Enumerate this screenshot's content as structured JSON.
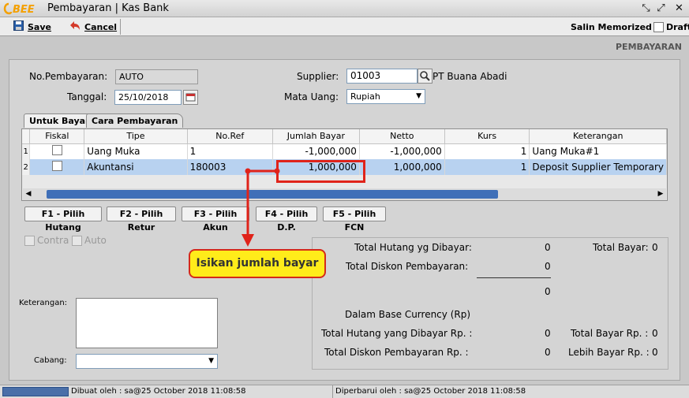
{
  "window": {
    "logo": "BEE",
    "title": "Pembayaran | Kas Bank"
  },
  "toolbar": {
    "save_label": "Save",
    "cancel_label": "Cancel",
    "salin_memorized": "Salin Memorized",
    "draft_label": "Draft"
  },
  "header": {
    "section_title": "PEMBAYARAN"
  },
  "form": {
    "no_pembayaran_label": "No.Pembayaran:",
    "no_pembayaran_value": "AUTO",
    "tanggal_label": "Tanggal:",
    "tanggal_value": "25/10/2018",
    "supplier_label": "Supplier:",
    "supplier_code": "01003",
    "supplier_name": "PT Buana Abadi",
    "mata_uang_label": "Mata Uang:",
    "mata_uang_value": "Rupiah"
  },
  "tabs": [
    {
      "label": "Untuk Bayar"
    },
    {
      "label": "Cara Pembayaran"
    }
  ],
  "grid": {
    "columns": [
      "Fiskal",
      "Tipe",
      "No.Ref",
      "Jumlah Bayar",
      "Netto",
      "Kurs",
      "Keterangan"
    ],
    "rows": [
      {
        "num": "1",
        "tipe": "Uang Muka",
        "noref": "1",
        "jumlah": "-1,000,000",
        "netto": "-1,000,000",
        "kurs": "1",
        "keterangan": "Uang Muka#1"
      },
      {
        "num": "2",
        "tipe": "Akuntansi",
        "noref": "180003",
        "jumlah": "1,000,000",
        "netto": "1,000,000",
        "kurs": "1",
        "keterangan": "Deposit Supplier Temporary"
      }
    ]
  },
  "function_buttons": [
    {
      "label": "F1 - Pilih Hutang"
    },
    {
      "label": "F2 - Pilih Retur"
    },
    {
      "label": "F3 - Pilih Akun"
    },
    {
      "label": "F4 - Pilih D.P."
    },
    {
      "label": "F5 - Pilih FCN"
    }
  ],
  "options": {
    "contra_label": "Contra",
    "auto_label": "Auto"
  },
  "bottom": {
    "keterangan_label": "Keterangan:",
    "cabang_label": "Cabang:"
  },
  "summary": {
    "total_hutang_label": "Total Hutang yg Dibayar:",
    "total_hutang_value": "0",
    "total_bayar_label": "Total Bayar:",
    "total_bayar_value": "0",
    "total_diskon_label": "Total Diskon Pembayaran:",
    "total_diskon_value": "0",
    "subtotal_value": "0",
    "base_currency_label": "Dalam Base Currency (Rp)",
    "total_hutang_rp_label": "Total Hutang yang Dibayar Rp. :",
    "total_hutang_rp_value": "0",
    "total_bayar_rp_label": "Total Bayar Rp. :",
    "total_bayar_rp_value": "0",
    "total_diskon_rp_label": "Total Diskon Pembayaran Rp. :",
    "total_diskon_rp_value": "0",
    "lebih_bayar_rp_label": "Lebih Bayar Rp. :",
    "lebih_bayar_rp_value": "0"
  },
  "annotation": {
    "callout_text": "Isikan jumlah bayar",
    "color": "#e0231a"
  },
  "status": {
    "dibuat_oleh": "Dibuat oleh : sa@25 October 2018  11:08:58",
    "diperbarui_oleh": "Diperbarui oleh : sa@25 October 2018  11:08:58"
  }
}
